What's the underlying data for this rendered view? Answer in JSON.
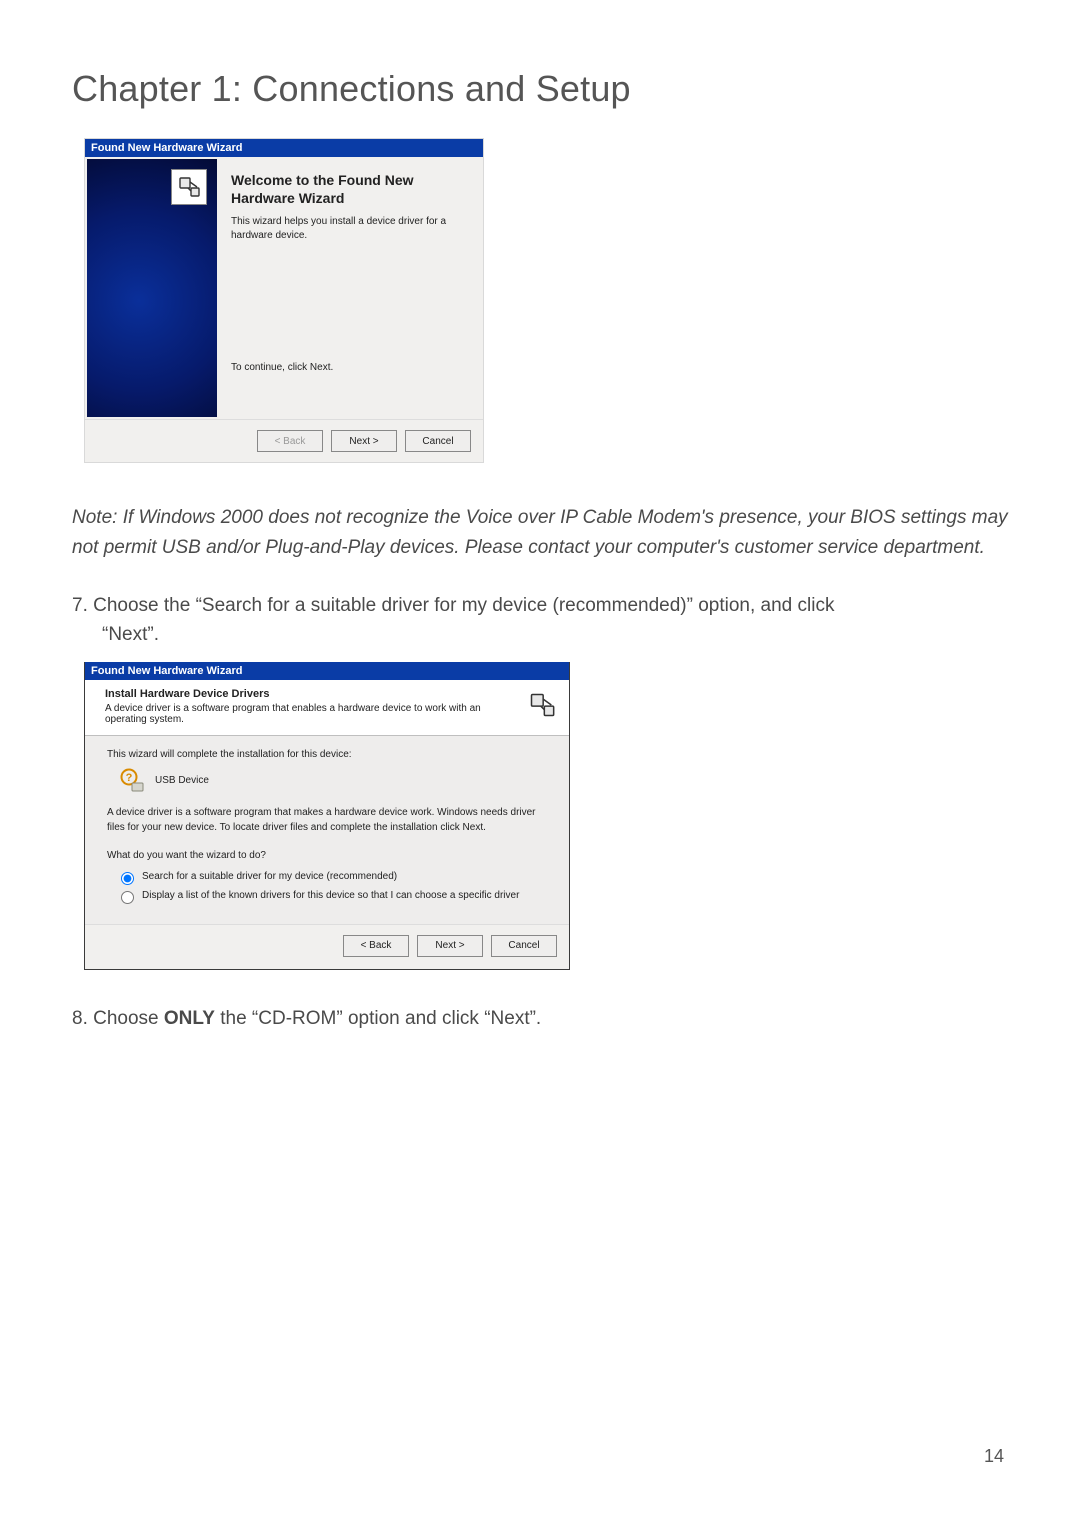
{
  "chapter_title": "Chapter 1: Connections and Setup",
  "wizard1": {
    "titlebar": "Found New Hardware Wizard",
    "heading": "Welcome to the Found New Hardware Wizard",
    "desc": "This wizard helps you install a device driver for a hardware device.",
    "continue_text": "To continue, click Next.",
    "buttons": {
      "back": "< Back",
      "next": "Next >",
      "cancel": "Cancel"
    }
  },
  "note_text": "Note: If Windows 2000 does not recognize the Voice over IP Cable Modem's presence, your BIOS settings may not permit USB and/or Plug-and-Play devices. Please contact your computer's customer service department.",
  "step7_prefix": "7. Choose the “Search for a suitable driver for my device (recommended)” option, and click",
  "step7_suffix": "“Next”.",
  "wizard2": {
    "titlebar": "Found New Hardware Wizard",
    "header_title": "Install Hardware Device Drivers",
    "header_desc": "A device driver is a software program that enables a hardware device to work with an operating system.",
    "line1": "This wizard will complete the installation for this device:",
    "device_name": "USB Device",
    "line2": "A device driver is a software program that makes a hardware device work. Windows needs driver files for your new device. To locate driver files and complete the installation click Next.",
    "question": "What do you want the wizard to do?",
    "opt1": "Search for a suitable driver for my device (recommended)",
    "opt2": "Display a list of the known drivers for this device so that I can choose a specific driver",
    "buttons": {
      "back": "< Back",
      "next": "Next >",
      "cancel": "Cancel"
    }
  },
  "step8": "8. Choose ONLY the “CD-ROM” option and click “Next”.",
  "step8_bold": "ONLY",
  "page_number": "14"
}
